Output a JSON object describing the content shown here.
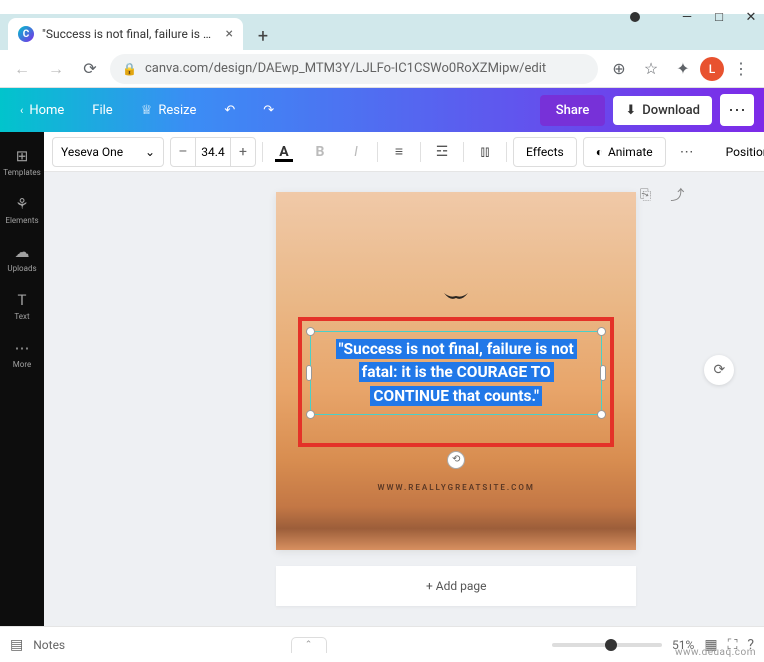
{
  "browser": {
    "tab_title": "\"Success is not final, failure is not…",
    "url": "canva.com/design/DAEwp_MTM3Y/LJLFo-IC1CSWo0RoXZMipw/edit",
    "avatar_letter": "L"
  },
  "canva_header": {
    "home": "Home",
    "file": "File",
    "resize": "Resize",
    "share": "Share",
    "download": "Download"
  },
  "sidebar": {
    "items": [
      {
        "icon": "⊞",
        "label": "Templates"
      },
      {
        "icon": "⚘",
        "label": "Elements"
      },
      {
        "icon": "☁",
        "label": "Uploads"
      },
      {
        "icon": "T",
        "label": "Text"
      },
      {
        "icon": "⋯",
        "label": "More"
      }
    ]
  },
  "toolbar": {
    "font_name": "Yeseva One",
    "font_size": "34.4",
    "effects": "Effects",
    "animate": "Animate",
    "position": "Position"
  },
  "design": {
    "quote_line1": "\"Success is not final, failure is not",
    "quote_line2": "fatal: it is the COURAGE TO",
    "quote_line3": "CONTINUE that counts.\"",
    "site_text": "WWW.REALLYGREATSITE.COM"
  },
  "add_page": "+ Add page",
  "bottom": {
    "notes": "Notes",
    "zoom": "51%"
  },
  "watermark": "www.deuaq.com"
}
